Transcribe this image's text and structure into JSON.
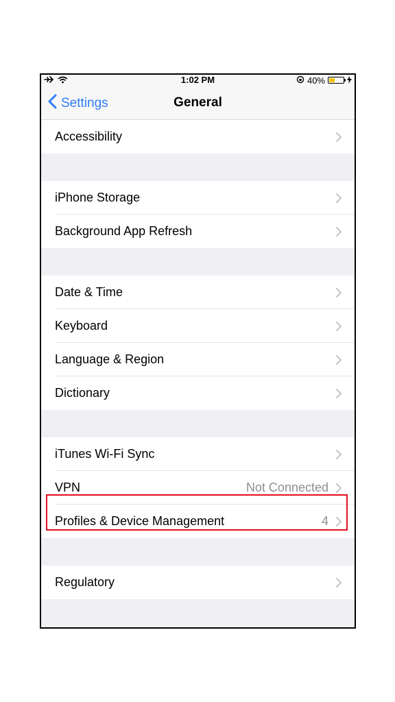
{
  "status_bar": {
    "time": "1:02 PM",
    "battery": "40%",
    "battery_level": 0.4,
    "icons": [
      "airplane-icon",
      "wifi-icon",
      "orientation-lock-icon",
      "battery-icon",
      "charging-bolt-icon"
    ]
  },
  "navbar": {
    "back_label": "Settings",
    "title": "General"
  },
  "groups": [
    {
      "rows": [
        {
          "label": "Accessibility"
        }
      ]
    },
    {
      "rows": [
        {
          "label": "iPhone Storage"
        },
        {
          "label": "Background App Refresh"
        }
      ]
    },
    {
      "rows": [
        {
          "label": "Date & Time"
        },
        {
          "label": "Keyboard"
        },
        {
          "label": "Language & Region"
        },
        {
          "label": "Dictionary"
        }
      ]
    },
    {
      "rows": [
        {
          "label": "iTunes Wi-Fi Sync"
        },
        {
          "label": "VPN",
          "value": "Not Connected"
        },
        {
          "label": "Profiles & Device Management",
          "value": "4"
        }
      ]
    },
    {
      "rows": [
        {
          "label": "Regulatory"
        }
      ]
    }
  ],
  "colors": {
    "accent": "#2f7cf6",
    "highlight_box": "#e0101e",
    "battery_fill": "#f5c400"
  }
}
